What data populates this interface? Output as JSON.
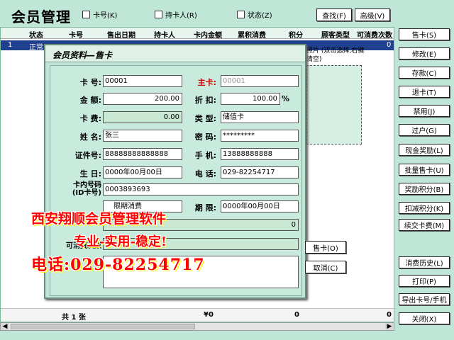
{
  "window": {
    "title": "会员管理"
  },
  "filters": [
    {
      "label": "卡号(K)"
    },
    {
      "label": "持卡人(R)"
    },
    {
      "label": "状态(Z)"
    }
  ],
  "top_buttons": {
    "find": "查找(F)",
    "advanced": "高级(V)"
  },
  "grid": {
    "columns": [
      "状态",
      "卡号",
      "售出日期",
      "持卡人",
      "卡内金额",
      "累积消费",
      "积分",
      "顾客类型",
      "可消费次数"
    ],
    "row": {
      "index": "1",
      "status": "正常",
      "count": "0"
    },
    "footer": {
      "total_label": "共 1 张",
      "amount": "¥0",
      "points": "0",
      "count": "0"
    }
  },
  "side_buttons": [
    "售卡(S)",
    "修改(E)",
    "存款(C)",
    "退卡(T)",
    "禁用(J)",
    "过户(G)",
    "现金奖励(L)",
    "批量售卡(U)",
    "奖励积分(B)",
    "扣减积分(K)",
    "续交卡费(M)",
    "消费历史(L)",
    "打印(P)",
    "导出卡号/手机",
    "关闭(X)"
  ],
  "dialog": {
    "title": "会员资料—售卡",
    "labels": {
      "card_no": "卡 号:",
      "main_card": "主卡:",
      "amount": "金 额:",
      "discount": "折 扣:",
      "fee": "卡 费:",
      "type": "类 型:",
      "name": "姓 名:",
      "password": "密 码:",
      "id_no": "证件号:",
      "mobile": "手 机:",
      "birthday": "生 日:",
      "phone": "电 话:",
      "inner_no": "卡内号码\n(ID卡号)",
      "limit": "期 限:",
      "times": "可消费次数"
    },
    "values": {
      "card_no": "00001",
      "main_card": "00001",
      "amount": "200.00",
      "discount": "100.00",
      "discount_unit": "%",
      "fee": "0.00",
      "type": "储值卡",
      "name": "张三",
      "password": "*********",
      "id_no": "88888888888888",
      "mobile": "13888888888",
      "birthday": "0000年00月00日",
      "phone": "029-82254717",
      "inner_no": "0003893693",
      "limit_check": "限期消费",
      "limit_date": "0000年00月00日",
      "points": "0"
    },
    "photo_label": "照片 (双击选择,右键清空)",
    "buttons": {
      "sell": "售卡(O)",
      "cancel": "取消(C)"
    }
  },
  "promo": {
    "line1": "西安翔顺会员管理软件",
    "line2": "专业-实用-稳定!",
    "line3": "电话:029-82254717"
  }
}
